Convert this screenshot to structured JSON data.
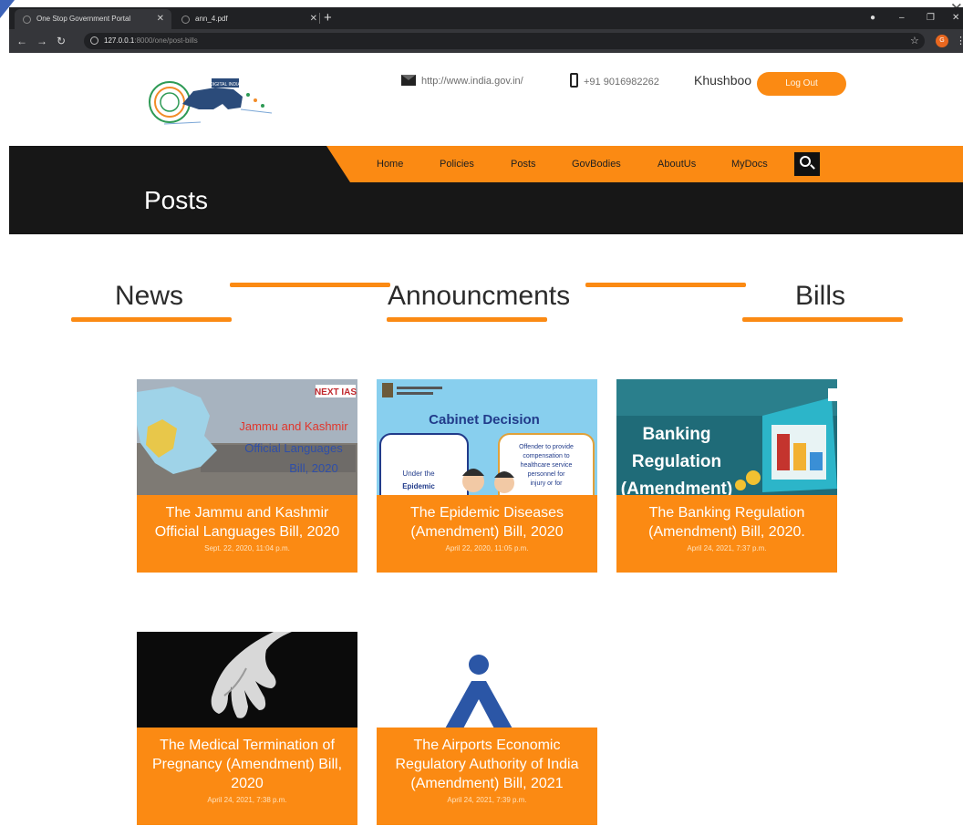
{
  "browser": {
    "tabs": [
      {
        "title": "One Stop Government Portal",
        "active": true
      },
      {
        "title": "ann_4.pdf",
        "active": false
      }
    ],
    "url_host": "127.0.0.1",
    "url_path": ":8000/one/post-bills",
    "extension_badge": "G"
  },
  "header": {
    "website": "http://www.india.gov.in/",
    "phone": "+91 9016982262",
    "username": "Khushboo",
    "logout_label": "Log Out",
    "logo_text": "DIGITAL INDIA"
  },
  "nav": {
    "items": [
      "Home",
      "Policies",
      "Posts",
      "GovBodies",
      "AboutUs",
      "MyDocs"
    ],
    "icon": "search-icon"
  },
  "hero": {
    "title": "Posts"
  },
  "categories": [
    "News",
    "Announcments",
    "Bills"
  ],
  "cards": [
    {
      "image_text": [
        "Jammu and Kashmir",
        "Official Languages",
        "Bill, 2020"
      ],
      "badge": "NEXT IAS",
      "title": "The Jammu and Kashmir Official Languages Bill, 2020",
      "date": "Sept. 22, 2020, 11:04 p.m."
    },
    {
      "image_text": [
        "Cabinet Decision",
        "Offender to provide",
        "compensation to",
        "healthcare service",
        "personnel for",
        "injury or for",
        "Under the",
        "Epidemic"
      ],
      "title": "The Epidemic Diseases (Amendment) Bill, 2020",
      "date": "April 22, 2020, 11:05 p.m."
    },
    {
      "image_text": [
        "Banking",
        "Regulation",
        "(Amendment)"
      ],
      "title": "The Banking Regulation (Amendment) Bill, 2020.",
      "date": "April 24, 2021, 7:37 p.m."
    },
    {
      "title": "The Medical Termination of Pregnancy (Amendment) Bill, 2020",
      "date": "April 24, 2021, 7:38 p.m."
    },
    {
      "title": "The Airports Economic Regulatory Authority of India (Amendment) Bill, 2021",
      "date": "April 24, 2021, 7:39 p.m."
    }
  ],
  "colors": {
    "accent": "#fb8a13",
    "dark": "#171717"
  }
}
